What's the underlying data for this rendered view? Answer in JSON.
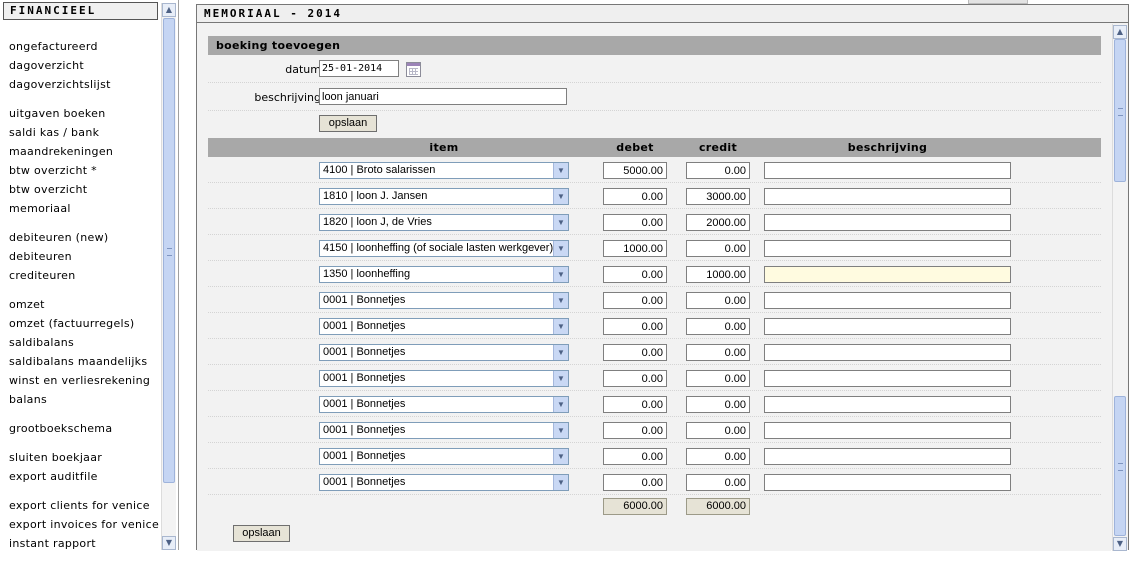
{
  "sidebar": {
    "title": "FINANCIEEL",
    "groups": [
      [
        "ongefactureerd",
        "dagoverzicht",
        "dagoverzichtslijst"
      ],
      [
        "uitgaven boeken",
        "saldi kas / bank",
        "maandrekeningen",
        "btw overzicht *",
        "btw overzicht",
        "memoriaal"
      ],
      [
        "debiteuren (new)",
        "debiteuren",
        "crediteuren"
      ],
      [
        "omzet",
        "omzet (factuurregels)",
        "saldibalans",
        "saldibalans maandelijks",
        "winst en verliesrekening",
        "balans"
      ],
      [
        "grootboekschema"
      ],
      [
        "sluiten boekjaar",
        "export auditfile"
      ],
      [
        "export clients for venice",
        "export invoices for venice",
        "instant rapport"
      ]
    ]
  },
  "main": {
    "title": "MEMORIAAL - 2014",
    "section_title": "boeking toevoegen",
    "datum_label": "datum",
    "datum_value": "25-01-2014",
    "beschrijving_label": "beschrijving",
    "beschrijving_value": "loon januari",
    "save_label": "opslaan",
    "columns": {
      "item": "item",
      "debet": "debet",
      "credit": "credit",
      "beschrijving": "beschrijving"
    },
    "rows": [
      {
        "item": "4100 | Broto salarissen",
        "debet": "5000.00",
        "credit": "0.00",
        "desc": ""
      },
      {
        "item": "1810 | loon J. Jansen",
        "debet": "0.00",
        "credit": "3000.00",
        "desc": ""
      },
      {
        "item": "1820 | loon J, de Vries",
        "debet": "0.00",
        "credit": "2000.00",
        "desc": ""
      },
      {
        "item": "4150 | loonheffing (of sociale lasten werkgever)",
        "debet": "1000.00",
        "credit": "0.00",
        "desc": ""
      },
      {
        "item": "1350 | loonheffing",
        "debet": "0.00",
        "credit": "1000.00",
        "desc": "",
        "focused": true
      },
      {
        "item": "0001 | Bonnetjes",
        "debet": "0.00",
        "credit": "0.00",
        "desc": ""
      },
      {
        "item": "0001 | Bonnetjes",
        "debet": "0.00",
        "credit": "0.00",
        "desc": ""
      },
      {
        "item": "0001 | Bonnetjes",
        "debet": "0.00",
        "credit": "0.00",
        "desc": ""
      },
      {
        "item": "0001 | Bonnetjes",
        "debet": "0.00",
        "credit": "0.00",
        "desc": ""
      },
      {
        "item": "0001 | Bonnetjes",
        "debet": "0.00",
        "credit": "0.00",
        "desc": ""
      },
      {
        "item": "0001 | Bonnetjes",
        "debet": "0.00",
        "credit": "0.00",
        "desc": ""
      },
      {
        "item": "0001 | Bonnetjes",
        "debet": "0.00",
        "credit": "0.00",
        "desc": ""
      },
      {
        "item": "0001 | Bonnetjes",
        "debet": "0.00",
        "credit": "0.00",
        "desc": ""
      }
    ],
    "total_debet": "6000.00",
    "total_credit": "6000.00"
  },
  "icons": {
    "calendar": "calendar-icon",
    "dropdown": "chevron-down-icon",
    "scroll_up": "chevron-up-icon",
    "scroll_down": "chevron-down-icon"
  }
}
